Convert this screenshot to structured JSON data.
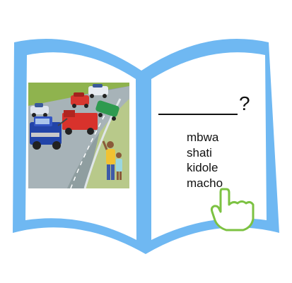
{
  "book": {
    "frame_color": "#6fb8f2",
    "inner_color": "#ffffff"
  },
  "illustration": {
    "icon": "traffic-accident-scene",
    "elements": [
      "blue-tow-truck",
      "red-truck",
      "green-car",
      "police-car",
      "white-car",
      "two-onlookers",
      "road",
      "grass"
    ]
  },
  "question": {
    "mark": "?"
  },
  "words": [
    {
      "label": "mbwa"
    },
    {
      "label": "shati"
    },
    {
      "label": "kidole"
    },
    {
      "label": "macho"
    }
  ],
  "pointer": {
    "icon": "pointing-hand-icon",
    "color": "#7cc242"
  }
}
